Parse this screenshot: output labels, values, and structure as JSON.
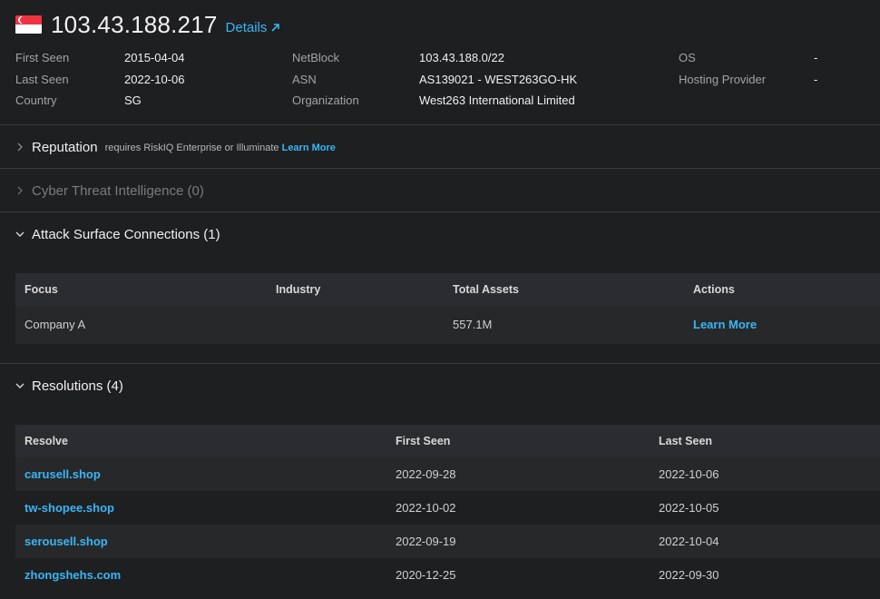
{
  "header": {
    "flag_icon": "singapore-flag-icon",
    "ip": "103.43.188.217",
    "details_label": "Details"
  },
  "info": {
    "first_seen_label": "First Seen",
    "first_seen": "2015-04-04",
    "last_seen_label": "Last Seen",
    "last_seen": "2022-10-06",
    "country_label": "Country",
    "country": "SG",
    "netblock_label": "NetBlock",
    "netblock": "103.43.188.0/22",
    "asn_label": "ASN",
    "asn": "AS139021 - WEST263GO-HK",
    "org_label": "Organization",
    "org": "West263 International Limited",
    "os_label": "OS",
    "os": "-",
    "hosting_label": "Hosting Provider",
    "hosting": "-"
  },
  "reputation": {
    "title": "Reputation",
    "requires_text": "requires RiskIQ Enterprise or Illuminate",
    "learn_more": "Learn More"
  },
  "cti": {
    "title": "Cyber Threat Intelligence (0)"
  },
  "attack_surface": {
    "title": "Attack Surface Connections (1)",
    "columns": [
      "Focus",
      "Industry",
      "Total Assets",
      "Actions"
    ],
    "rows": [
      {
        "focus": "Company A",
        "industry": "",
        "total_assets": "557.1M",
        "action": "Learn More"
      }
    ]
  },
  "resolutions": {
    "title": "Resolutions (4)",
    "columns": [
      "Resolve",
      "First Seen",
      "Last Seen"
    ],
    "rows": [
      {
        "resolve": "carusell.shop",
        "first_seen": "2022-09-28",
        "last_seen": "2022-10-06"
      },
      {
        "resolve": "tw-shopee.shop",
        "first_seen": "2022-10-02",
        "last_seen": "2022-10-05"
      },
      {
        "resolve": "serousell.shop",
        "first_seen": "2022-09-19",
        "last_seen": "2022-10-04"
      },
      {
        "resolve": "zhongshehs.com",
        "first_seen": "2020-12-25",
        "last_seen": "2022-09-30"
      }
    ]
  },
  "colors": {
    "accent": "#38b6f5",
    "background": "#1e1f21",
    "table_header": "#2b2c2f"
  }
}
